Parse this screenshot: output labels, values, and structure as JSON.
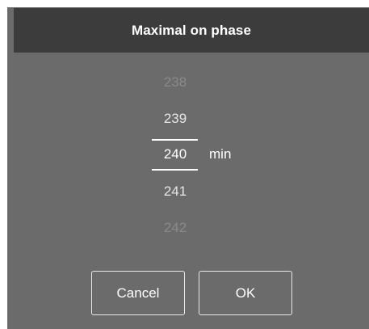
{
  "dialog": {
    "title": "Maximal on phase"
  },
  "picker": {
    "values": [
      "238",
      "239",
      "240",
      "241",
      "242"
    ],
    "selected": "240",
    "unit": "min"
  },
  "buttons": {
    "cancel_label": "Cancel",
    "ok_label": "OK"
  },
  "colors": {
    "dialog_background": "#6b6b6b",
    "header_background": "#3c3c3c",
    "text_primary": "#ffffff",
    "text_faded": "#8a8a8a"
  }
}
